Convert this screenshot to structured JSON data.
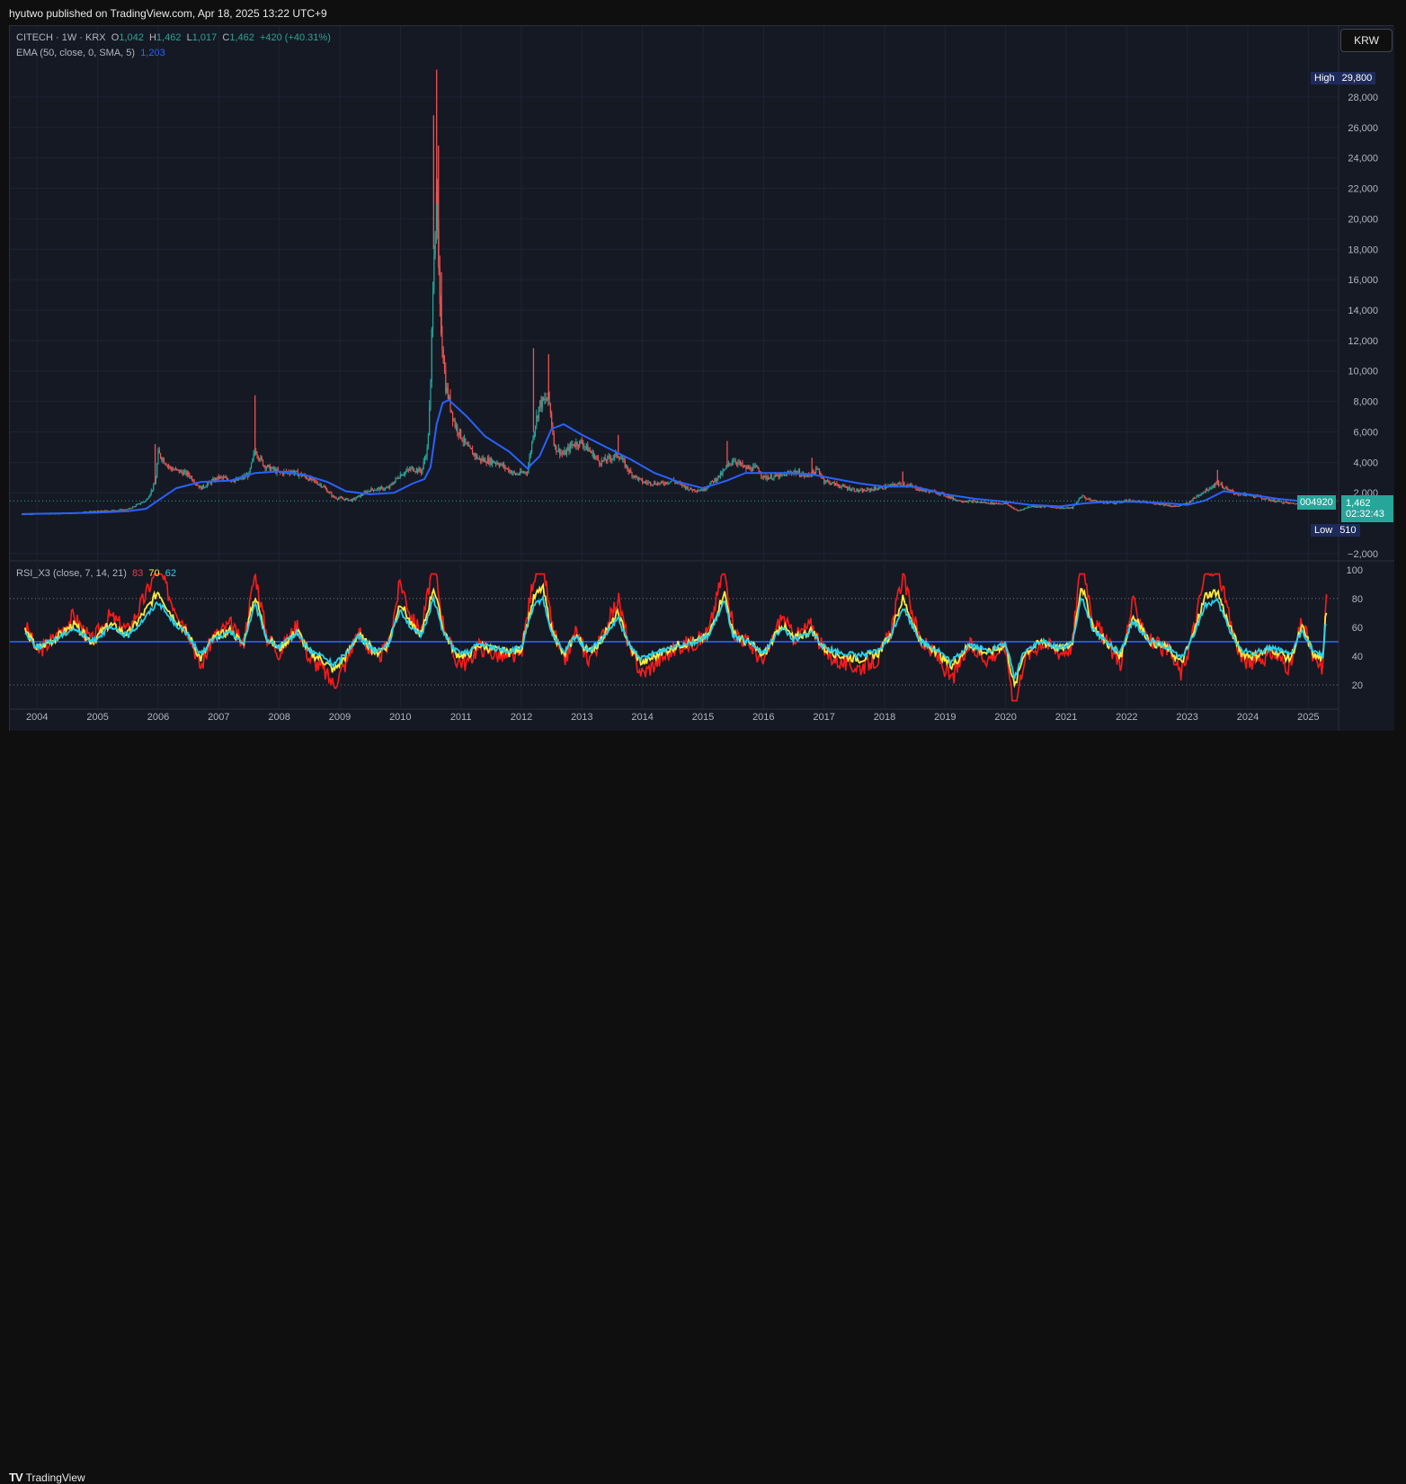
{
  "header": {
    "publisher": "hyutwo published on TradingView.com, Apr 18, 2025 13:22 UTC+9"
  },
  "legend": {
    "symbol": "CITECH · 1W · KRX",
    "o_label": "O",
    "o_value": "1,042",
    "h_label": "H",
    "h_value": "1,462",
    "l_label": "L",
    "l_value": "1,017",
    "c_label": "C",
    "c_value": "1,462",
    "change": "+420 (+40.31%)",
    "ema_label": "EMA (50, close, 0, SMA, 5)",
    "ema_value": "1,203",
    "rsi_label": "RSI_X3 (close, 7, 14, 21)",
    "rsi_v1": "83",
    "rsi_v2": "70",
    "rsi_v3": "62"
  },
  "currency": "KRW",
  "tags": {
    "high_label": "High",
    "high_value": "29,800",
    "low_label": "Low",
    "low_value": "510",
    "symbol_code": "004920",
    "last_price": "1,462",
    "countdown": "02:32:43"
  },
  "footer": {
    "brand": "TradingView"
  },
  "colors": {
    "background": "#151924",
    "up": "#26a69a",
    "down": "#ef5350",
    "ema": "#2962ff",
    "rsi7": "#ff1a1a",
    "rsi14": "#ffeb3b",
    "rsi21": "#22d3ee",
    "rsi_mid": "#2962ff"
  },
  "chart_data": [
    {
      "type": "candlestick",
      "title": "CITECH · 1W · KRX",
      "currency": "KRW",
      "y_ticks": [
        -2000,
        2000,
        4000,
        6000,
        8000,
        10000,
        12000,
        14000,
        16000,
        18000,
        20000,
        22000,
        24000,
        26000,
        28000
      ],
      "y_tick_labels": [
        "−2,000",
        "2,000",
        "4,000",
        "6,000",
        "8,000",
        "10,000",
        "12,000",
        "14,000",
        "16,000",
        "18,000",
        "20,000",
        "22,000",
        "24,000",
        "26,000",
        "28,000"
      ],
      "ylim": [
        -2300,
        30300
      ],
      "x_ticks": [
        2004,
        2005,
        2006,
        2007,
        2008,
        2009,
        2010,
        2011,
        2012,
        2013,
        2014,
        2015,
        2016,
        2017,
        2018,
        2019,
        2020,
        2021,
        2022,
        2023,
        2024,
        2025
      ],
      "x_tick_labels": [
        "2004",
        "2005",
        "2006",
        "2007",
        "2008",
        "2009",
        "2010",
        "2011",
        "2012",
        "2013",
        "2014",
        "2015",
        "2016",
        "2017",
        "2018",
        "2019",
        "2020",
        "2021",
        "2022",
        "2023",
        "2024",
        "2025"
      ],
      "xlim": [
        2003.55,
        2025.5
      ],
      "price_path": [
        [
          2003.75,
          600
        ],
        [
          2004.5,
          650
        ],
        [
          2005.0,
          780
        ],
        [
          2005.5,
          900
        ],
        [
          2005.8,
          1500
        ],
        [
          2005.95,
          2600
        ],
        [
          2006.0,
          4600
        ],
        [
          2006.2,
          3600
        ],
        [
          2006.5,
          3200
        ],
        [
          2006.7,
          2300
        ],
        [
          2007.0,
          3000
        ],
        [
          2007.3,
          2800
        ],
        [
          2007.5,
          3200
        ],
        [
          2007.6,
          4800
        ],
        [
          2007.75,
          3800
        ],
        [
          2008.0,
          3300
        ],
        [
          2008.2,
          3400
        ],
        [
          2008.4,
          3100
        ],
        [
          2008.7,
          2500
        ],
        [
          2008.9,
          1700
        ],
        [
          2009.2,
          1500
        ],
        [
          2009.5,
          2200
        ],
        [
          2009.8,
          2300
        ],
        [
          2010.0,
          3200
        ],
        [
          2010.2,
          3600
        ],
        [
          2010.35,
          3400
        ],
        [
          2010.45,
          5000
        ],
        [
          2010.5,
          9000
        ],
        [
          2010.55,
          18000
        ],
        [
          2010.6,
          21000
        ],
        [
          2010.65,
          14000
        ],
        [
          2010.75,
          9000
        ],
        [
          2010.9,
          6500
        ],
        [
          2011.1,
          5000
        ],
        [
          2011.3,
          4200
        ],
        [
          2011.6,
          4000
        ],
        [
          2011.9,
          3200
        ],
        [
          2012.1,
          3400
        ],
        [
          2012.2,
          6000
        ],
        [
          2012.3,
          7800
        ],
        [
          2012.45,
          8200
        ],
        [
          2012.55,
          5000
        ],
        [
          2012.7,
          4500
        ],
        [
          2012.85,
          5200
        ],
        [
          2013.0,
          5300
        ],
        [
          2013.3,
          4000
        ],
        [
          2013.6,
          4500
        ],
        [
          2013.8,
          3300
        ],
        [
          2014.0,
          2700
        ],
        [
          2014.3,
          2600
        ],
        [
          2014.5,
          2800
        ],
        [
          2014.8,
          2200
        ],
        [
          2015.0,
          2200
        ],
        [
          2015.3,
          3200
        ],
        [
          2015.5,
          4200
        ],
        [
          2015.7,
          3600
        ],
        [
          2015.9,
          3600
        ],
        [
          2016.0,
          3000
        ],
        [
          2016.3,
          3100
        ],
        [
          2016.5,
          3400
        ],
        [
          2016.7,
          3100
        ],
        [
          2016.9,
          3500
        ],
        [
          2017.0,
          2800
        ],
        [
          2017.3,
          2400
        ],
        [
          2017.6,
          2100
        ],
        [
          2017.9,
          2300
        ],
        [
          2018.3,
          2600
        ],
        [
          2018.6,
          2200
        ],
        [
          2018.9,
          2000
        ],
        [
          2019.2,
          1500
        ],
        [
          2019.5,
          1400
        ],
        [
          2019.8,
          1300
        ],
        [
          2020.0,
          1300
        ],
        [
          2020.2,
          800
        ],
        [
          2020.4,
          1100
        ],
        [
          2020.7,
          1100
        ],
        [
          2020.9,
          1000
        ],
        [
          2021.1,
          1000
        ],
        [
          2021.25,
          1800
        ],
        [
          2021.4,
          1500
        ],
        [
          2021.6,
          1400
        ],
        [
          2021.8,
          1300
        ],
        [
          2022.0,
          1500
        ],
        [
          2022.2,
          1400
        ],
        [
          2022.5,
          1300
        ],
        [
          2022.8,
          1100
        ],
        [
          2023.0,
          1300
        ],
        [
          2023.2,
          1900
        ],
        [
          2023.4,
          2400
        ],
        [
          2023.5,
          2700
        ],
        [
          2023.65,
          2200
        ],
        [
          2023.85,
          1900
        ],
        [
          2024.1,
          1800
        ],
        [
          2024.4,
          1500
        ],
        [
          2024.7,
          1300
        ],
        [
          2025.0,
          1300
        ],
        [
          2025.15,
          1100
        ],
        [
          2025.3,
          1462
        ]
      ],
      "spikes": [
        [
          2005.95,
          5200
        ],
        [
          2007.6,
          8400
        ],
        [
          2010.55,
          26800
        ],
        [
          2010.6,
          29800
        ],
        [
          2010.63,
          24800
        ],
        [
          2010.68,
          16500
        ],
        [
          2012.2,
          11500
        ],
        [
          2012.45,
          11100
        ],
        [
          2013.6,
          5800
        ],
        [
          2015.4,
          5400
        ],
        [
          2016.8,
          4300
        ],
        [
          2018.3,
          3400
        ],
        [
          2023.5,
          3500
        ]
      ],
      "ohlc_last": {
        "open": 1042,
        "high": 1462,
        "low": 1017,
        "close": 1462
      },
      "high": 29800,
      "low": 510,
      "ema_path": [
        [
          2003.75,
          600
        ],
        [
          2004.5,
          650
        ],
        [
          2005.0,
          700
        ],
        [
          2005.5,
          780
        ],
        [
          2005.8,
          950
        ],
        [
          2006.0,
          1500
        ],
        [
          2006.3,
          2300
        ],
        [
          2006.7,
          2700
        ],
        [
          2007.2,
          2800
        ],
        [
          2007.6,
          3300
        ],
        [
          2008.0,
          3400
        ],
        [
          2008.4,
          3200
        ],
        [
          2008.8,
          2700
        ],
        [
          2009.1,
          2100
        ],
        [
          2009.5,
          1900
        ],
        [
          2009.9,
          2000
        ],
        [
          2010.2,
          2600
        ],
        [
          2010.4,
          2900
        ],
        [
          2010.5,
          3700
        ],
        [
          2010.6,
          6500
        ],
        [
          2010.7,
          7900
        ],
        [
          2010.8,
          8100
        ],
        [
          2011.1,
          7000
        ],
        [
          2011.4,
          5700
        ],
        [
          2011.8,
          4700
        ],
        [
          2012.1,
          3600
        ],
        [
          2012.3,
          4400
        ],
        [
          2012.5,
          6200
        ],
        [
          2012.7,
          6500
        ],
        [
          2013.0,
          5800
        ],
        [
          2013.4,
          5000
        ],
        [
          2013.8,
          4200
        ],
        [
          2014.2,
          3300
        ],
        [
          2014.6,
          2700
        ],
        [
          2015.0,
          2300
        ],
        [
          2015.4,
          2800
        ],
        [
          2015.7,
          3300
        ],
        [
          2016.0,
          3300
        ],
        [
          2016.4,
          3300
        ],
        [
          2016.8,
          3200
        ],
        [
          2017.2,
          2900
        ],
        [
          2017.6,
          2600
        ],
        [
          2018.0,
          2400
        ],
        [
          2018.5,
          2400
        ],
        [
          2019.0,
          1900
        ],
        [
          2019.5,
          1600
        ],
        [
          2020.0,
          1400
        ],
        [
          2020.4,
          1200
        ],
        [
          2020.9,
          1100
        ],
        [
          2021.3,
          1300
        ],
        [
          2021.7,
          1400
        ],
        [
          2022.2,
          1400
        ],
        [
          2022.7,
          1300
        ],
        [
          2023.0,
          1200
        ],
        [
          2023.3,
          1500
        ],
        [
          2023.6,
          2100
        ],
        [
          2024.0,
          1900
        ],
        [
          2024.5,
          1600
        ],
        [
          2025.0,
          1400
        ],
        [
          2025.3,
          1400
        ]
      ]
    },
    {
      "type": "line",
      "title": "RSI_X3 (close, 7, 14, 21)",
      "y_ticks": [
        20,
        40,
        60,
        80,
        100
      ],
      "y_tick_labels": [
        "20",
        "40",
        "60",
        "80",
        "100"
      ],
      "ylim": [
        5,
        103
      ],
      "levels": [
        20,
        50,
        80
      ],
      "series": [
        {
          "name": "83",
          "color": "#ff1a1a",
          "period": 7,
          "last": 83
        },
        {
          "name": "70",
          "color": "#ffeb3b",
          "period": 14,
          "last": 70
        },
        {
          "name": "62",
          "color": "#22d3ee",
          "period": 21,
          "last": 62
        }
      ],
      "anchors": [
        [
          2003.8,
          58
        ],
        [
          2004.0,
          45
        ],
        [
          2004.3,
          52
        ],
        [
          2004.6,
          62
        ],
        [
          2004.9,
          50
        ],
        [
          2005.2,
          62
        ],
        [
          2005.5,
          55
        ],
        [
          2005.8,
          72
        ],
        [
          2006.0,
          85
        ],
        [
          2006.2,
          70
        ],
        [
          2006.5,
          55
        ],
        [
          2006.7,
          38
        ],
        [
          2006.9,
          52
        ],
        [
          2007.2,
          58
        ],
        [
          2007.4,
          48
        ],
        [
          2007.6,
          82
        ],
        [
          2007.8,
          52
        ],
        [
          2008.0,
          45
        ],
        [
          2008.3,
          58
        ],
        [
          2008.5,
          42
        ],
        [
          2008.7,
          38
        ],
        [
          2008.9,
          30
        ],
        [
          2009.1,
          40
        ],
        [
          2009.3,
          55
        ],
        [
          2009.6,
          42
        ],
        [
          2009.8,
          48
        ],
        [
          2010.0,
          78
        ],
        [
          2010.2,
          60
        ],
        [
          2010.35,
          55
        ],
        [
          2010.55,
          88
        ],
        [
          2010.7,
          60
        ],
        [
          2010.9,
          42
        ],
        [
          2011.1,
          40
        ],
        [
          2011.3,
          48
        ],
        [
          2011.5,
          45
        ],
        [
          2011.8,
          42
        ],
        [
          2012.0,
          45
        ],
        [
          2012.2,
          80
        ],
        [
          2012.35,
          88
        ],
        [
          2012.5,
          58
        ],
        [
          2012.7,
          40
        ],
        [
          2012.9,
          55
        ],
        [
          2013.1,
          42
        ],
        [
          2013.3,
          50
        ],
        [
          2013.6,
          70
        ],
        [
          2013.8,
          45
        ],
        [
          2014.0,
          35
        ],
        [
          2014.3,
          42
        ],
        [
          2014.6,
          48
        ],
        [
          2014.9,
          50
        ],
        [
          2015.1,
          55
        ],
        [
          2015.35,
          85
        ],
        [
          2015.5,
          55
        ],
        [
          2015.8,
          48
        ],
        [
          2016.0,
          40
        ],
        [
          2016.3,
          62
        ],
        [
          2016.5,
          52
        ],
        [
          2016.8,
          58
        ],
        [
          2017.0,
          45
        ],
        [
          2017.3,
          40
        ],
        [
          2017.6,
          38
        ],
        [
          2017.9,
          42
        ],
        [
          2018.1,
          55
        ],
        [
          2018.3,
          80
        ],
        [
          2018.6,
          50
        ],
        [
          2018.9,
          42
        ],
        [
          2019.1,
          32
        ],
        [
          2019.4,
          48
        ],
        [
          2019.7,
          42
        ],
        [
          2020.0,
          48
        ],
        [
          2020.15,
          18
        ],
        [
          2020.3,
          42
        ],
        [
          2020.6,
          50
        ],
        [
          2020.9,
          45
        ],
        [
          2021.1,
          48
        ],
        [
          2021.25,
          90
        ],
        [
          2021.45,
          60
        ],
        [
          2021.7,
          48
        ],
        [
          2021.9,
          40
        ],
        [
          2022.1,
          68
        ],
        [
          2022.4,
          50
        ],
        [
          2022.7,
          45
        ],
        [
          2022.9,
          35
        ],
        [
          2023.1,
          55
        ],
        [
          2023.3,
          82
        ],
        [
          2023.5,
          85
        ],
        [
          2023.7,
          60
        ],
        [
          2023.9,
          42
        ],
        [
          2024.1,
          40
        ],
        [
          2024.4,
          45
        ],
        [
          2024.7,
          38
        ],
        [
          2024.9,
          60
        ],
        [
          2025.1,
          40
        ],
        [
          2025.25,
          38
        ],
        [
          2025.3,
          83
        ]
      ]
    }
  ]
}
